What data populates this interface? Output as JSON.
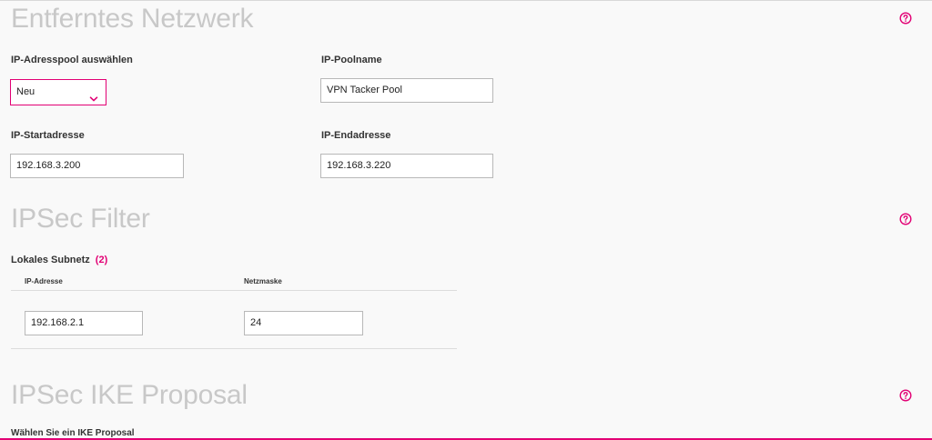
{
  "sections": {
    "remote_network": {
      "title": "Entferntes Netzwerk",
      "pool_select_label": "IP-Adresspool auswählen",
      "pool_select_value": "Neu",
      "pool_name_label": "IP-Poolname",
      "pool_name_value": "VPN Tacker Pool",
      "start_label": "IP-Startadresse",
      "start_value": "192.168.3.200",
      "end_label": "IP-Endadresse",
      "end_value": "192.168.3.220"
    },
    "ipsec_filter": {
      "title": "IPSec Filter",
      "local_subnet_label": "Lokales Subnetz",
      "local_subnet_count": "(2)",
      "col_ip": "IP-Adresse",
      "col_mask": "Netzmaske",
      "row_ip_value": "192.168.2.1",
      "row_mask_value": "24"
    },
    "ike_proposal": {
      "title": "IPSec IKE Proposal",
      "choose_label": "Wählen Sie ein IKE Proposal"
    }
  },
  "colors": {
    "accent": "#e20074",
    "title_gray": "#c8c8c8",
    "background": "#f9f9f9"
  },
  "icons": {
    "help": "help-circle-icon",
    "dropdown": "chevron-down-icon"
  }
}
